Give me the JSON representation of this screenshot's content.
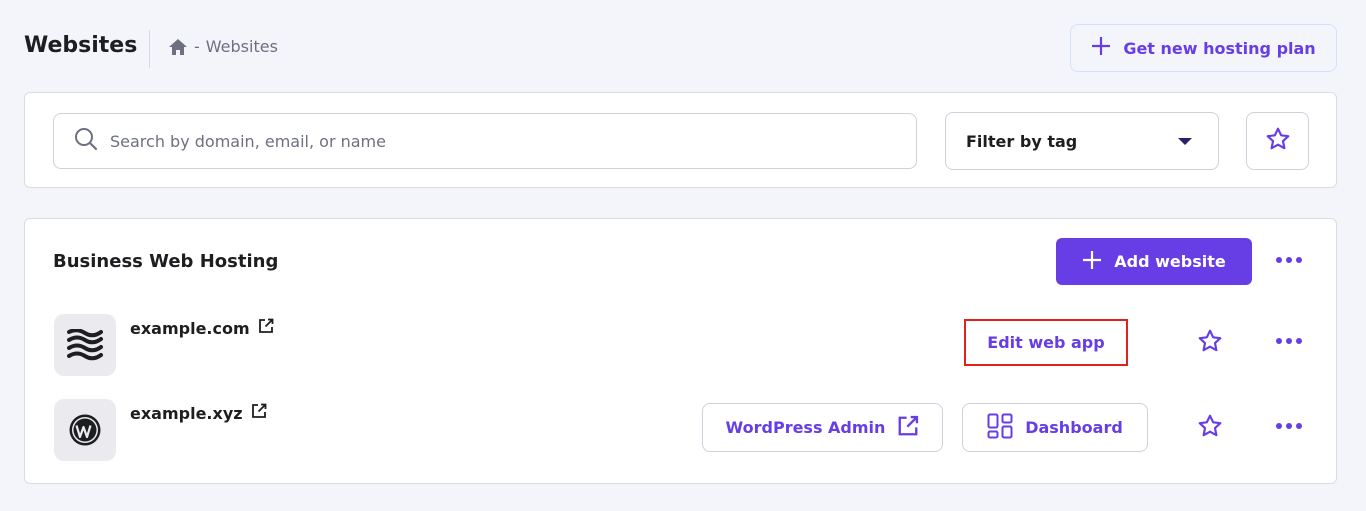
{
  "header": {
    "title": "Websites",
    "breadcrumb": {
      "home_icon": "home-icon",
      "separator": "-",
      "current": "Websites"
    },
    "new_hosting_button": {
      "label": "Get new hosting plan",
      "icon": "plus-icon"
    }
  },
  "search": {
    "placeholder": "Search by domain, email, or name",
    "icon": "search-icon",
    "filter": {
      "selected": "Filter by tag",
      "icon": "caret-down-icon"
    },
    "favorites_icon": "star-icon"
  },
  "hosting": {
    "title": "Business Web Hosting",
    "add_button": {
      "label": "Add website",
      "icon": "plus-icon"
    },
    "menu_icon": "more-dots-icon",
    "sites": [
      {
        "domain": "example.com",
        "logo": "waves-logo-icon",
        "external_icon": "external-link-icon",
        "actions": [
          {
            "label": "Edit web app",
            "highlighted": true
          }
        ]
      },
      {
        "domain": "example.xyz",
        "logo": "wordpress-logo-icon",
        "external_icon": "external-link-icon",
        "actions": [
          {
            "label": "WordPress Admin",
            "icon": "external-link-icon"
          },
          {
            "label": "Dashboard",
            "icon": "dashboard-grid-icon"
          }
        ]
      }
    ]
  },
  "colors": {
    "accent": "#673de6",
    "background": "#f4f4fb",
    "card": "#ffffff",
    "text": "#1d1e20",
    "muted": "#6d7081",
    "highlight_border": "#e0241a"
  }
}
